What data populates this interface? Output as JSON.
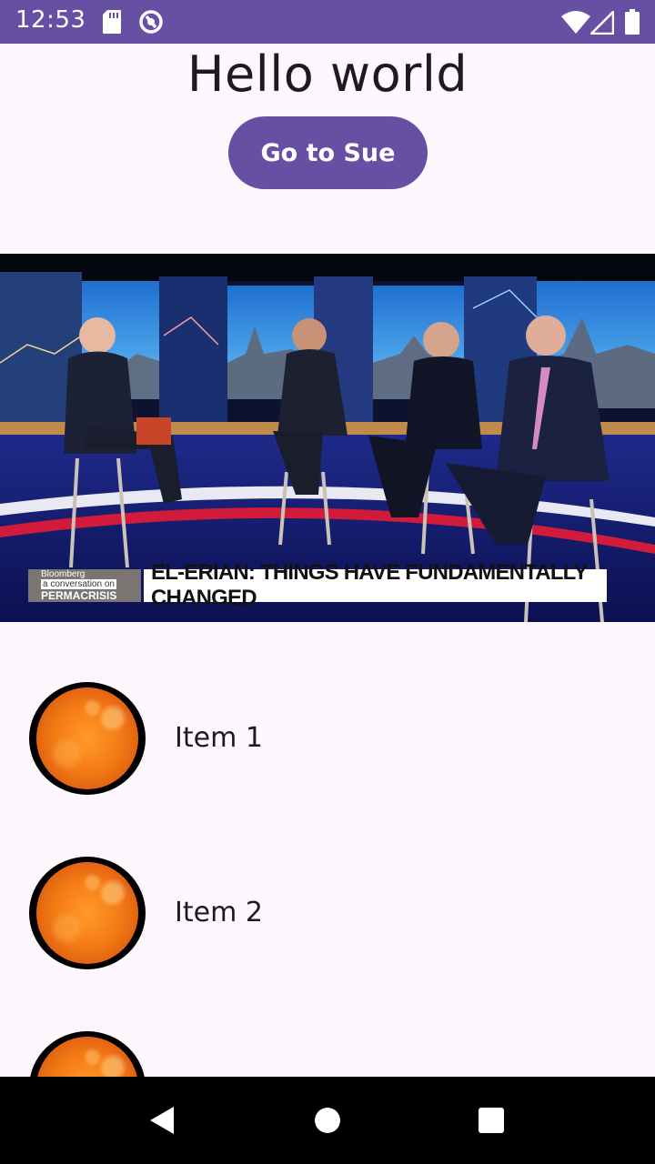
{
  "status_bar": {
    "time": "12:53",
    "icons": [
      "sd-card-icon",
      "sync-icon",
      "wifi-icon",
      "signal-icon",
      "battery-icon"
    ],
    "background": "#6750a4"
  },
  "main": {
    "title": "Hello world",
    "button_label": "Go to Sue",
    "accent": "#6750a4"
  },
  "video": {
    "brand_line1": "Bloomberg",
    "brand_line2": "a conversation on",
    "brand_line3": "PERMACRISIS",
    "headline": "EL-ERIAN: THINGS HAVE FUNDAMENTALLY CHANGED"
  },
  "list": {
    "items": [
      {
        "label": "Item 1",
        "icon": "sun-image"
      },
      {
        "label": "Item 2",
        "icon": "sun-image"
      },
      {
        "label": "",
        "icon": "sun-image"
      }
    ]
  },
  "nav_bar": {
    "icons": [
      "back-icon",
      "home-icon",
      "recents-icon"
    ]
  }
}
